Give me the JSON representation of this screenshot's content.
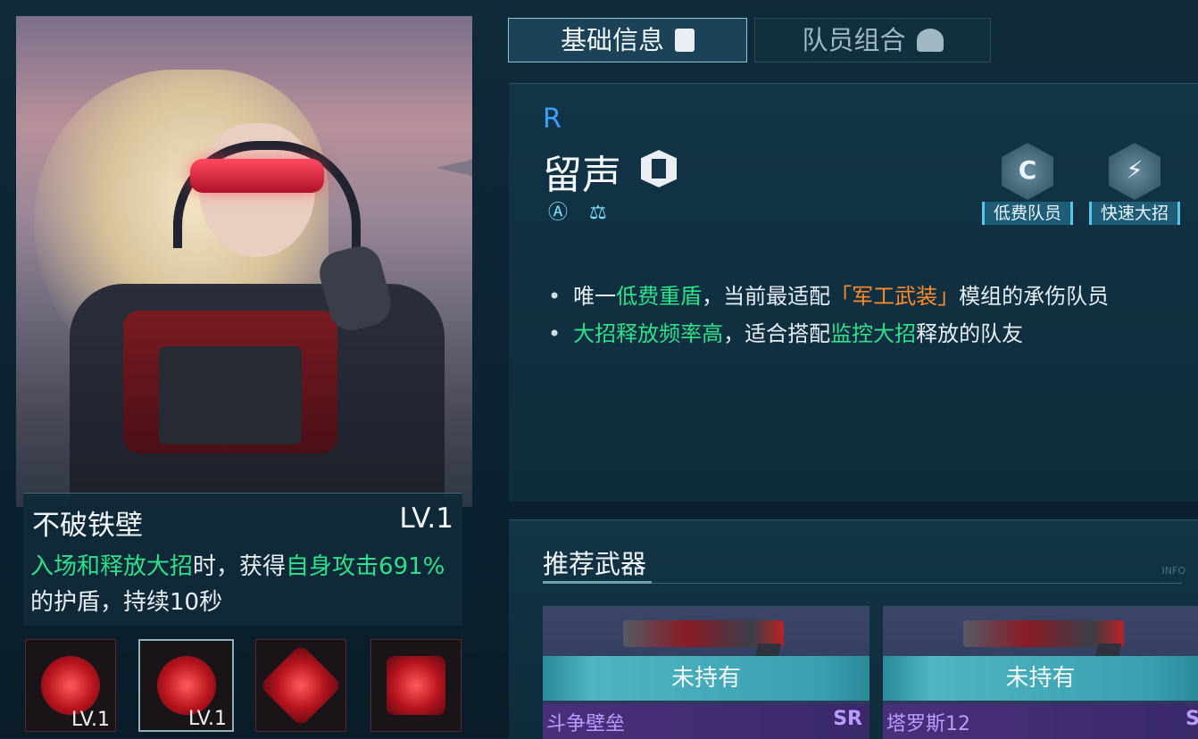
{
  "character": {
    "rarity": "R",
    "name": "留声"
  },
  "tabs": {
    "basic": "基础信息",
    "team": "队员组合"
  },
  "badges": [
    {
      "glyph": "C",
      "label": "低费队员"
    },
    {
      "glyph": "⚡",
      "label": "快速大招"
    }
  ],
  "traits": {
    "line1_pre": "唯一",
    "line1_hl": "低费重盾",
    "line1_mid": "，当前最适配",
    "line1_tag": "「军工武装」",
    "line1_post": "模组的承伤队员",
    "line2_hl1": "大招释放频率高",
    "line2_mid": "，适合搭配",
    "line2_hl2": "监控大招",
    "line2_post": "释放的队友"
  },
  "skill": {
    "name": "不破铁壁",
    "level": "LV.1",
    "desc_hl1": "入场和释放大招",
    "desc_mid1": "时，获得",
    "desc_hl2": "自身攻击691%",
    "desc_post": "的护盾，持续10秒"
  },
  "skill_icons": [
    {
      "name": "skill-icon-1",
      "level": "LV.1"
    },
    {
      "name": "skill-icon-2",
      "level": "LV.1"
    },
    {
      "name": "skill-icon-3",
      "level": ""
    },
    {
      "name": "skill-icon-4",
      "level": ""
    }
  ],
  "weapons": {
    "title": "推荐武器",
    "info_tag": "INFO",
    "cards": [
      {
        "name": "斗争壁垒",
        "rarity": "SR",
        "status": "未持有"
      },
      {
        "name": "塔罗斯12",
        "rarity": "S",
        "status": "未持有"
      }
    ]
  },
  "colors": {
    "highlight": "#2fe08a",
    "rarity_r": "#3aa0ff",
    "tag": "#ff8a2a",
    "weapon_name": "#b89cff"
  }
}
